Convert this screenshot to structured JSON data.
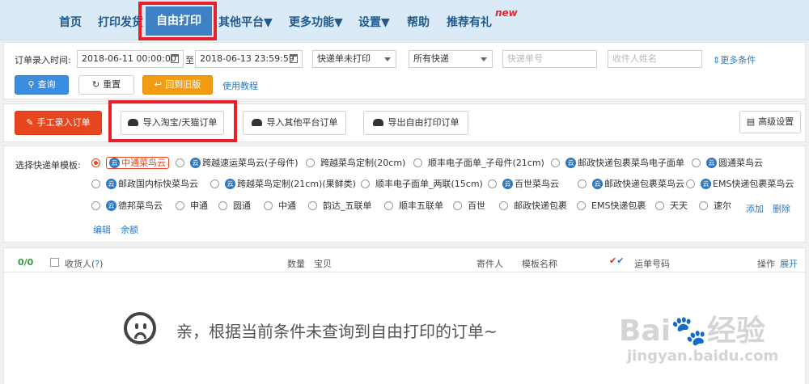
{
  "nav": {
    "items": [
      "首页",
      "打印发货",
      "自由打印",
      "其他平台▼",
      "更多功能▼",
      "设置▼",
      "帮助",
      "推荐有礼"
    ],
    "new_badge": "new"
  },
  "filter": {
    "time_label": "订单录入时间:",
    "start_time": "2018-06-11 00:00:00",
    "to": "至",
    "end_time": "2018-06-13 23:59:59",
    "status_select": "快递单未打印",
    "express_select": "所有快递",
    "waybill_placeholder": "快递单号",
    "receiver_placeholder": "收件人姓名",
    "more_conditions": "更多条件",
    "query_btn": "查询",
    "reset_btn": "重置",
    "back_old_btn": "回到旧版",
    "tutorial_link": "使用教程"
  },
  "actions": {
    "manual_btn": "手工录入订单",
    "import_taobao_btn": "导入淘宝/天猫订单",
    "import_other_btn": "导入其他平台订单",
    "export_btn": "导出自由打印订单",
    "advanced_btn": "高级设置"
  },
  "templates": {
    "label": "选择快递单模板:",
    "row1": [
      {
        "name": "中通菜鸟云",
        "cloud": true,
        "selected": true
      },
      {
        "name": "跨越速运菜鸟云(子母件)",
        "cloud": true
      },
      {
        "name": "跨越菜鸟定制(20cm)",
        "cloud": false
      },
      {
        "name": "顺丰电子面单_子母件(21cm)",
        "cloud": false
      },
      {
        "name": "邮政快递包裹菜鸟电子面单",
        "cloud": true
      },
      {
        "name": "圆通菜鸟云",
        "cloud": true
      }
    ],
    "row2": [
      {
        "name": "邮政国内标快菜鸟云",
        "cloud": true
      },
      {
        "name": "跨越菜鸟定制(21cm)(果鲜类)",
        "cloud": true
      },
      {
        "name": "顺丰电子面单_两联(15cm)",
        "cloud": false
      },
      {
        "name": "百世菜鸟云",
        "cloud": true
      },
      {
        "name": "邮政快递包裹菜鸟云",
        "cloud": true
      },
      {
        "name": "EMS快递包裹菜鸟云",
        "cloud": true
      }
    ],
    "row3": [
      {
        "name": "德邦菜鸟云",
        "cloud": true
      },
      {
        "name": "申通",
        "cloud": false
      },
      {
        "name": "圆通",
        "cloud": false
      },
      {
        "name": "中通",
        "cloud": false
      },
      {
        "name": "韵达_五联单",
        "cloud": false
      },
      {
        "name": "顺丰五联单",
        "cloud": false
      },
      {
        "name": "百世",
        "cloud": false
      },
      {
        "name": "邮政快递包裹",
        "cloud": false
      },
      {
        "name": "EMS快递包裹",
        "cloud": false
      },
      {
        "name": "天天",
        "cloud": false
      },
      {
        "name": "速尔",
        "cloud": false
      }
    ],
    "cloud_icon": "云",
    "add_link": "添加",
    "delete_link": "删除",
    "edit_link": "编辑",
    "balance_link": "余额"
  },
  "table": {
    "count": "0/0",
    "receiver": "收货人(",
    "help": "?",
    "receiver_close": ")",
    "qty": "数量",
    "item": "宝贝",
    "sender": "寄件人",
    "template": "模板名称",
    "waybill": "运单号码",
    "ops": "操作",
    "expand": "展开",
    "empty_message": "亲，根据当前条件未查询到自由打印的订单~"
  },
  "watermark": {
    "brand": "Bai",
    "brand2": "经验",
    "url": "jingyan.baidu.com"
  },
  "colors": {
    "accent_red": "#e62129",
    "nav_blue": "#3f82c4",
    "link_blue": "#2b79c2"
  }
}
